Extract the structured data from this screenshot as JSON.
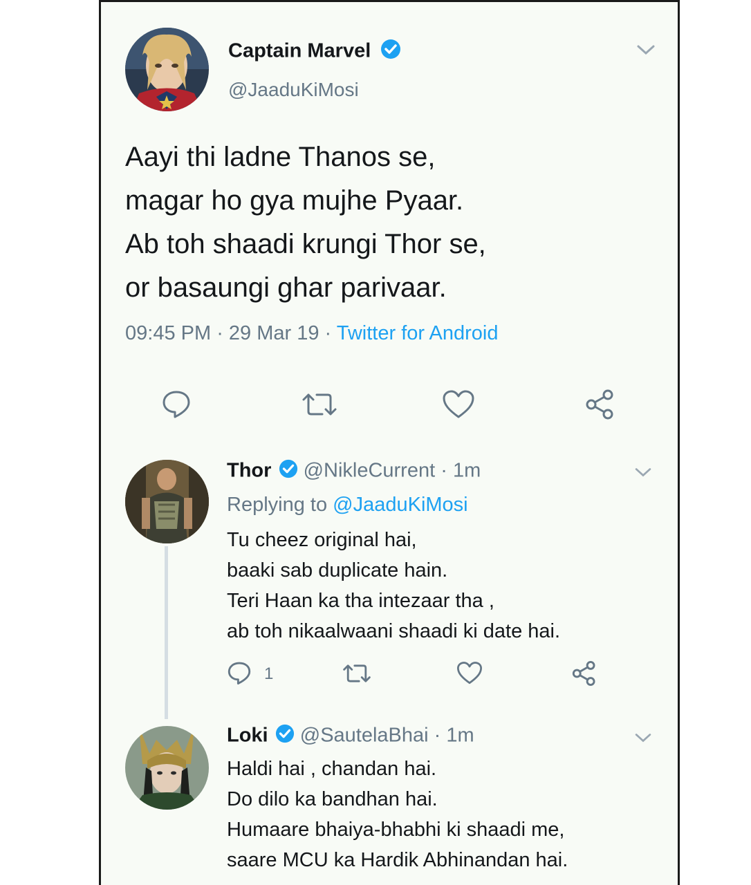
{
  "main_tweet": {
    "display_name": "Captain Marvel",
    "handle": "@JaaduKiMosi",
    "lines": [
      "Aayi thi ladne Thanos se,",
      "magar ho gya mujhe Pyaar.",
      "Ab toh shaadi krungi Thor se,",
      "or basaungi ghar parivaar."
    ],
    "time": "09:45 PM",
    "date": "29 Mar 19",
    "source": "Twitter for Android",
    "separator": " · ",
    "icons": {
      "reply": "reply-icon",
      "retweet": "retweet-icon",
      "like": "heart-icon",
      "share": "share-icon",
      "menu": "chevron-down-icon"
    }
  },
  "replies": [
    {
      "display_name": "Thor",
      "handle": "@NikleCurrent",
      "age": "1m",
      "replying_prefix": "Replying to ",
      "replying_to": "@JaaduKiMosi",
      "lines": [
        "Tu cheez original hai,",
        "baaki sab duplicate hain.",
        "Teri Haan ka tha intezaar tha ,",
        "ab toh nikaalwaani shaadi ki date hai."
      ],
      "reply_count": "1"
    },
    {
      "display_name": "Loki",
      "handle": "@SautelaBhai",
      "age": "1m",
      "lines": [
        "Haldi hai , chandan hai.",
        "Do dilo ka bandhan hai.",
        "Humaare bhaiya-bhabhi ki shaadi me,",
        "saare MCU ka Hardik Abhinandan hai."
      ]
    }
  ],
  "colors": {
    "accent": "#1da1f2",
    "muted": "#657786",
    "text": "#14171a"
  }
}
